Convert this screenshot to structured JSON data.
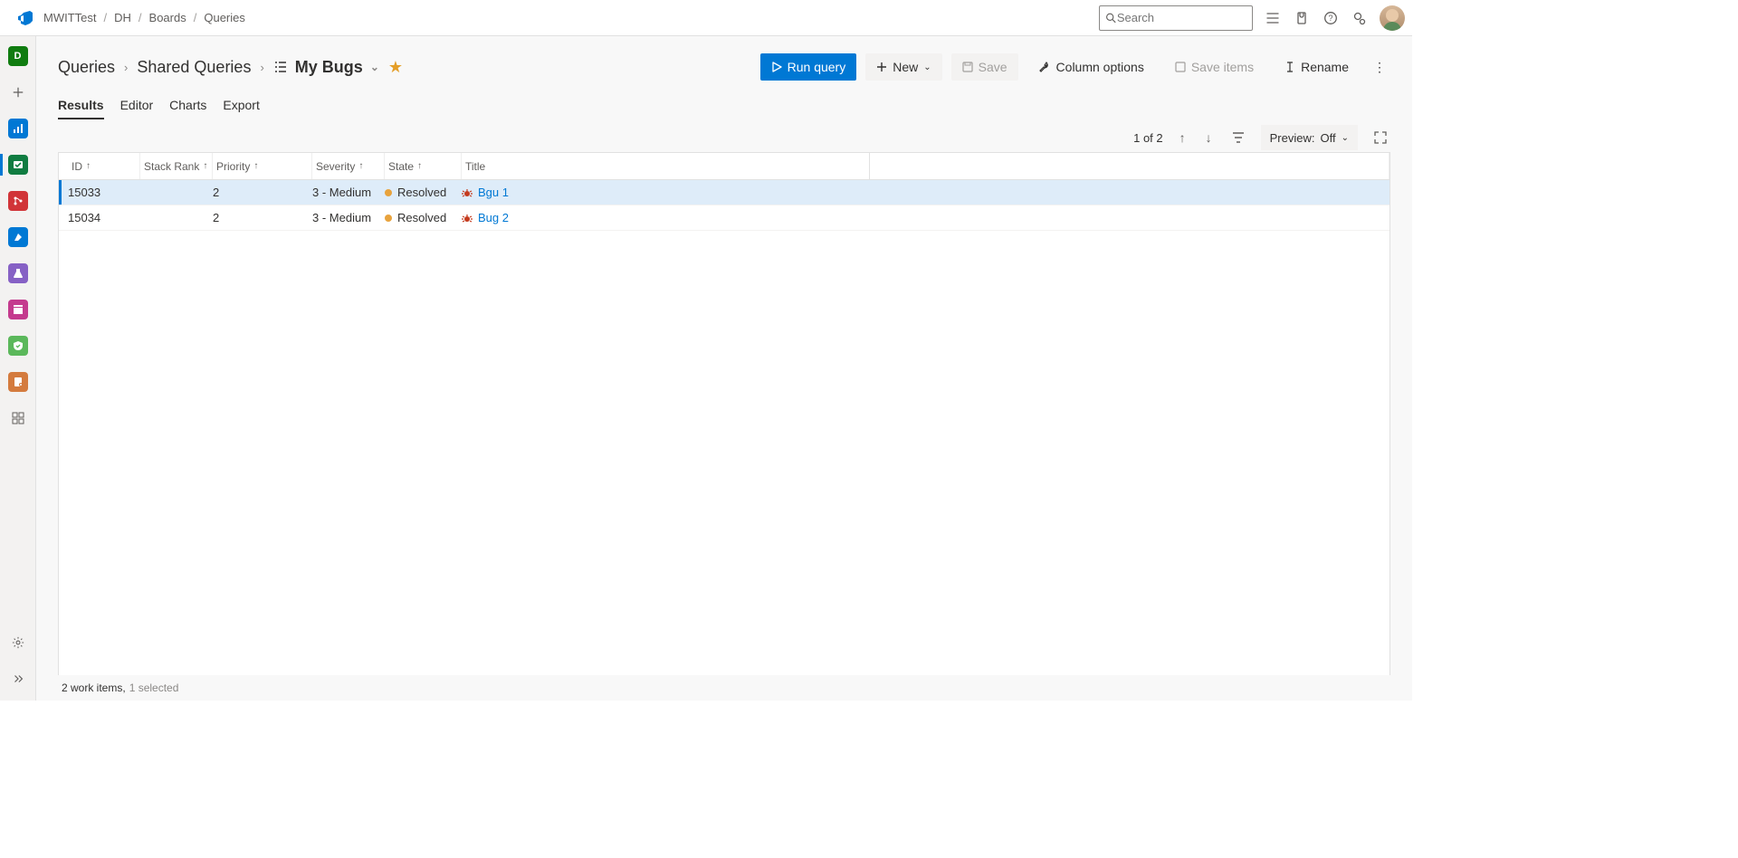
{
  "breadcrumb": {
    "org": "MWITTest",
    "project": "DH",
    "section": "Boards",
    "sub": "Queries"
  },
  "search": {
    "placeholder": "Search"
  },
  "sidebar": {
    "project_initial": "D"
  },
  "page": {
    "level1": "Queries",
    "level2": "Shared Queries",
    "query_name": "My Bugs"
  },
  "toolbar": {
    "run": "Run query",
    "new": "New",
    "save": "Save",
    "columns": "Column options",
    "saveitems": "Save items",
    "rename": "Rename"
  },
  "tabs": {
    "results": "Results",
    "editor": "Editor",
    "charts": "Charts",
    "export": "Export"
  },
  "subtool": {
    "counter": "1 of 2",
    "preview_label": "Preview:",
    "preview_state": "Off"
  },
  "columns": {
    "id": "ID",
    "stack": "Stack Rank",
    "priority": "Priority",
    "severity": "Severity",
    "state": "State",
    "title": "Title"
  },
  "rows": [
    {
      "id": "15033",
      "stack": "",
      "priority": "2",
      "severity": "3 - Medium",
      "state": "Resolved",
      "title": "Bgu 1",
      "selected": true
    },
    {
      "id": "15034",
      "stack": "",
      "priority": "2",
      "severity": "3 - Medium",
      "state": "Resolved",
      "title": "Bug 2",
      "selected": false
    }
  ],
  "status": {
    "work_items": "2 work items,",
    "selected": "1 selected"
  }
}
